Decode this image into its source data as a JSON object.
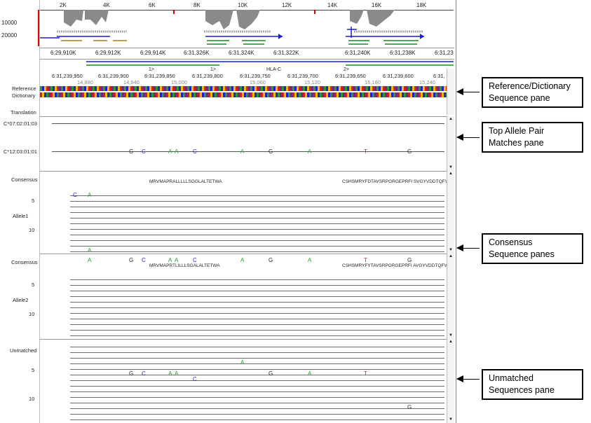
{
  "track": {
    "ticks": [
      "2K",
      "4K",
      "6K",
      "8K",
      "10K",
      "12K",
      "14K",
      "16K",
      "18K"
    ],
    "y_labels": [
      "10000",
      "20000"
    ]
  },
  "coords": [
    "6:29,910K",
    "6:29,912K",
    "6:29,914K",
    "6:31,326K",
    "6:31,324K",
    "6:31,322K",
    "6:31,240K",
    "6:31,238K",
    "6:31,23"
  ],
  "reference": {
    "markers": [
      "1>",
      "1>",
      "HLA-C",
      "2>"
    ],
    "positions": [
      "6:31,239,950",
      "6:31,239,900",
      "6:31,239,850",
      "6:31,239,800",
      "6:31,239,750",
      "6:31,239,700",
      "6:31,239,650",
      "6:31,239,600",
      "6:31,"
    ],
    "offsets": [
      "14,880",
      "14,940",
      "15,000",
      "15,060",
      "15,120",
      "15,180",
      "15,240"
    ],
    "label_ref": "Reference",
    "label_dict": "Dictionary",
    "label_translation": "Translation"
  },
  "top_pair": {
    "alleles": [
      "C*07:02:01:03",
      "C*12:03:01:01"
    ],
    "marks": [
      "G",
      "C",
      "A",
      "A",
      "C",
      "A",
      "G",
      "A",
      "T",
      "G"
    ]
  },
  "consensus1": {
    "label": "Consensus",
    "protein_left": "MRVMAPRALLLLLSGGLALTETWA",
    "protein_right": "CSHSMRYFDTAVSRPGRGEPRFI SVGYVDDTQFVRF",
    "allele_label": "Allele1",
    "row_numbers": [
      "5",
      "10"
    ],
    "marks": [
      "C",
      "A",
      "A"
    ]
  },
  "consensus2": {
    "label": "Consensus",
    "protein_left": "MRVMAPRTLILLLSGALALTETWA",
    "protein_right": "CSHSMRYFYTAVSRPGRGEPRFI AVGYVDDTQFVRF",
    "allele_label": "Allele2",
    "row_numbers": [
      "5",
      "10"
    ],
    "marks": [
      "A",
      "G",
      "C",
      "A",
      "A",
      "C",
      "A",
      "G",
      "A",
      "T",
      "G"
    ]
  },
  "unmatched": {
    "label": "Unmatched",
    "row_numbers": [
      "5",
      "10"
    ],
    "marks": [
      "G",
      "C",
      "A",
      "A",
      "C",
      "A",
      "G",
      "A",
      "T",
      "G"
    ]
  },
  "callouts": [
    {
      "line1": "Reference/Dictionary",
      "line2": "Sequence pane"
    },
    {
      "line1": "Top Allele Pair",
      "line2": "Matches pane"
    },
    {
      "line1": "Consensus",
      "line2": "Sequence panes"
    },
    {
      "line1": "Unmatched",
      "line2": "Sequences pane"
    }
  ],
  "colors": {
    "coverage": "#8a8a8a",
    "blue_line": "#1a1adc",
    "green_line": "#1a8a1a",
    "A": "#2a9a2a",
    "C": "#2222cc",
    "G": "#222222",
    "T": "#d02020",
    "red_axis": "#dd0000"
  }
}
